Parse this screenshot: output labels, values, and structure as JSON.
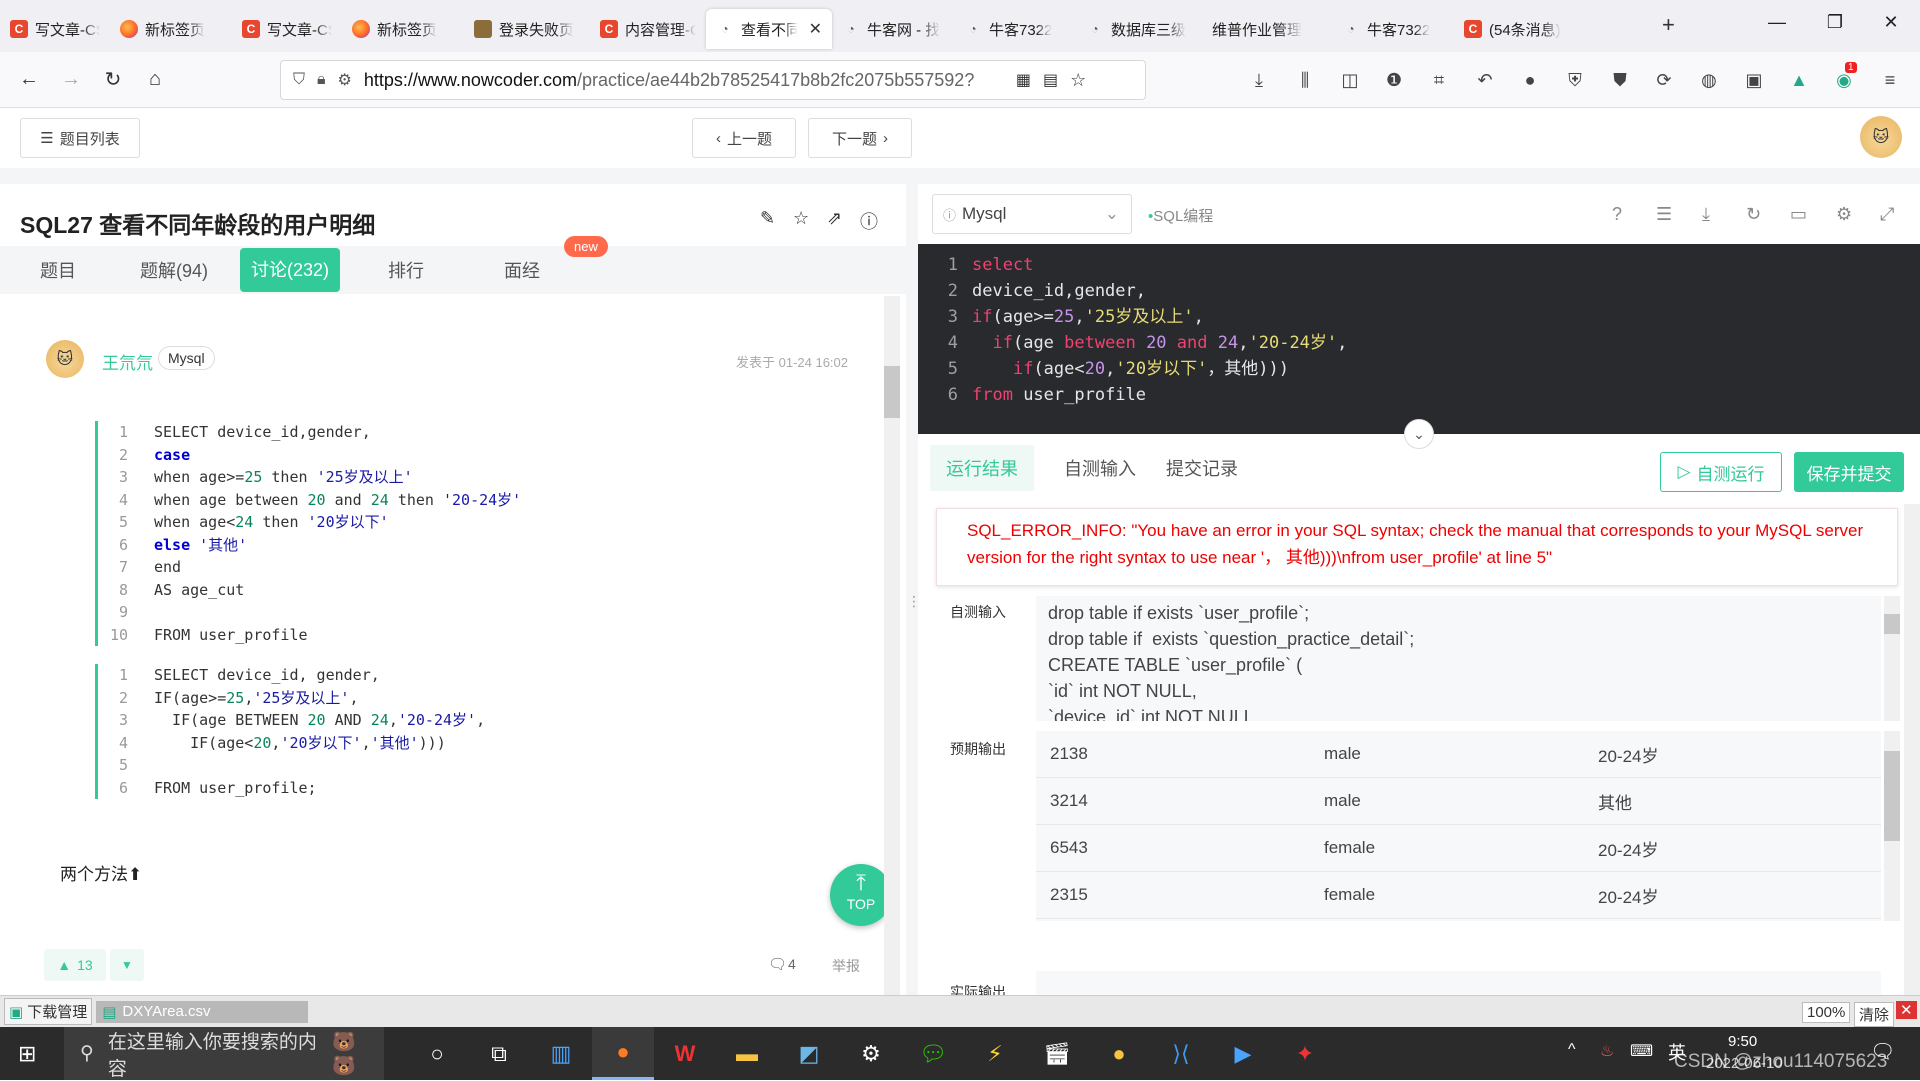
{
  "browser": {
    "tabs": [
      {
        "icon": "c",
        "label": "写文章-CS"
      },
      {
        "icon": "ff",
        "label": "新标签页"
      },
      {
        "icon": "c",
        "label": "写文章-CS"
      },
      {
        "icon": "ff",
        "label": "新标签页"
      },
      {
        "icon": "img",
        "label": "登录失败页"
      },
      {
        "icon": "c",
        "label": "内容管理-C"
      },
      {
        "icon": "nk",
        "label": "查看不同",
        "active": true
      },
      {
        "icon": "nk",
        "label": "牛客网 - 找"
      },
      {
        "icon": "nk",
        "label": "牛客7322"
      },
      {
        "icon": "nk",
        "label": "数据库三级"
      },
      {
        "icon": "none",
        "label": "维普作业管理"
      },
      {
        "icon": "nk",
        "label": "牛客7322"
      },
      {
        "icon": "c",
        "label": "(54条消息)"
      }
    ],
    "url_host": "https://www.nowcoder.com",
    "url_path": "/practice/ae44b2b78525417b8b2fc2075b557592?",
    "ext_badge": "1"
  },
  "topnav": {
    "list_label": "题目列表",
    "prev_label": "上一题",
    "next_label": "下一题"
  },
  "problem": {
    "title": "SQL27  查看不同年龄段的用户明细",
    "tabs": [
      "题目",
      "题解(94)",
      "讨论(232)",
      "排行",
      "面经"
    ],
    "new_badge": "new"
  },
  "post": {
    "author": "王氘氘",
    "tag": "Mysql",
    "time": "发表于 01-24 16:02",
    "footer_text": "两个方法⬆",
    "likes": "13",
    "comments": "4",
    "report": "举报"
  },
  "editor": {
    "language": "Mysql",
    "mode": "SQL编程",
    "lines": [
      "select",
      "device_id,gender,",
      "if(age>=25,'25岁及以上',",
      " if(age between 20 and 24,'20-24岁',",
      "  if(age<20,'20岁以下', 其他)))",
      "from user_profile"
    ]
  },
  "result": {
    "tabs": [
      "运行结果",
      "自测输入",
      "提交记录"
    ],
    "run_label": "自测运行",
    "submit_label": "保存并提交",
    "error": "SQL_ERROR_INFO: \"You have an error in your SQL syntax; check the manual that corresponds to your MySQL server version for the right syntax to use near '， 其他)))\\nfrom user_profile' at line 5\"",
    "input_label": "自测输入",
    "input_lines": [
      "drop table if exists `user_profile`;",
      "drop table if  exists `question_practice_detail`;",
      "CREATE TABLE `user_profile` (",
      "`id` int NOT NULL,",
      "`device_id` int NOT NULL,"
    ],
    "expected_label": "预期输出",
    "expected_rows": [
      [
        "2138",
        "male",
        "20-24岁"
      ],
      [
        "3214",
        "male",
        "其他"
      ],
      [
        "6543",
        "female",
        "20-24岁"
      ],
      [
        "2315",
        "female",
        "20-24岁"
      ]
    ],
    "actual_label": "实际输出"
  },
  "download": {
    "label": "下载管理",
    "file": "DXYArea.csv",
    "zoom": "100%",
    "clear": "清除"
  },
  "taskbar": {
    "search_placeholder": "在这里输入你要搜索的内容",
    "ime": "英",
    "time": "9:50",
    "date": "2022-06-10",
    "watermark": "CSDN @zhou114075623"
  },
  "colors": {
    "accent": "#32ca99",
    "editor_bg": "#282a2e",
    "error": "#e00000"
  }
}
